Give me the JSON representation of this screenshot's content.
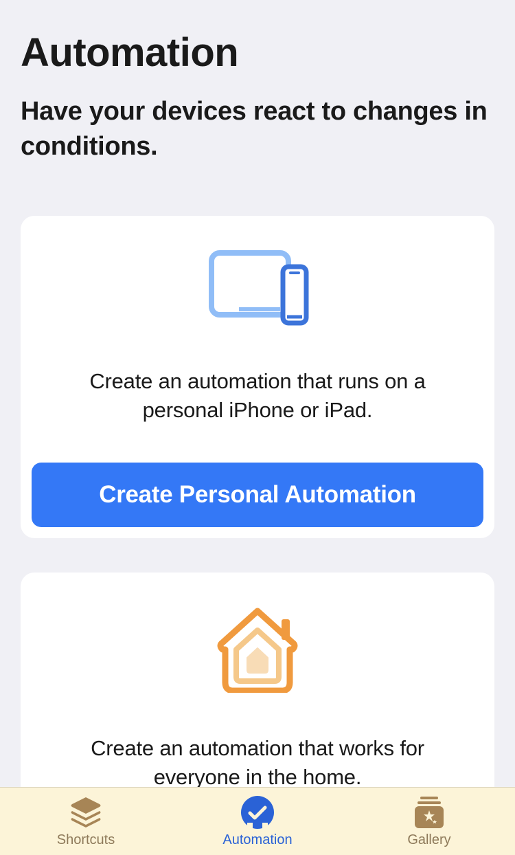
{
  "header": {
    "title": "Automation",
    "subtitle": "Have your devices react to changes in conditions."
  },
  "cards": {
    "personal": {
      "description": "Create an automation that runs on a personal iPhone or iPad.",
      "button_label": "Create Personal Automation"
    },
    "home": {
      "description": "Create an automation that works for everyone in the home."
    }
  },
  "tabs": {
    "shortcuts": "Shortcuts",
    "automation": "Automation",
    "gallery": "Gallery"
  }
}
